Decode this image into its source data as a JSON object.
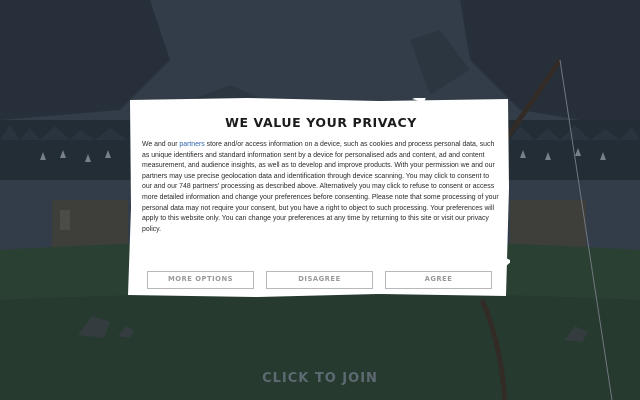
{
  "dialog": {
    "title": "WE VALUE YOUR PRIVACY",
    "body_before_link": "We and our ",
    "body_link": "partners",
    "body_after_link": " store and/or access information on a device, such as cookies and process personal data, such as unique identifiers and standard information sent by a device for personalised ads and content, ad and content measurement, and audience insights, as well as to develop and improve products. With your permission we and our partners may use precise geolocation data and identification through device scanning. You may click to consent to our and our 748 partners' processing as described above. Alternatively you may click to refuse to consent or access more detailed information and change your preferences before consenting. Please note that some processing of your personal data may not require your consent, but you have a right to object to such processing. Your preferences will apply to this website only. You can change your preferences at any time by returning to this site or visit our privacy policy.",
    "buttons": {
      "more_options": "MORE OPTIONS",
      "disagree": "DISAGREE",
      "agree": "AGREE"
    }
  },
  "game": {
    "join_label": "CLICK TO JOIN"
  },
  "colors": {
    "link": "#2e66b0",
    "button_border": "#b8b8b8",
    "button_text": "#9a9a9a",
    "join_text": "#5e6a72"
  }
}
